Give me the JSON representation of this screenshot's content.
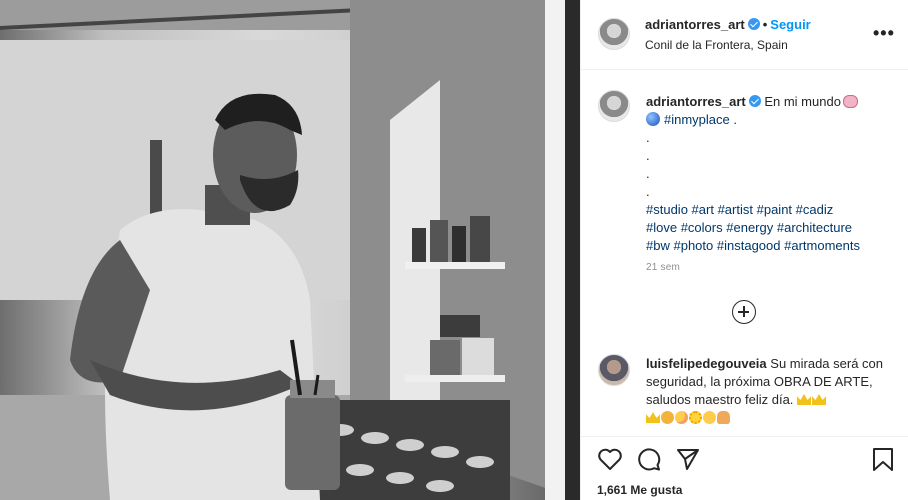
{
  "post": {
    "username": "adriantorres_art",
    "follow_label": "Seguir",
    "separator": "•",
    "location": "Conil de la Frontera, Spain",
    "more_label": "•••"
  },
  "caption": {
    "username": "adriantorres_art",
    "text": "En mi mundo",
    "place_tag": "#inmyplace",
    "place_suffix": ".",
    "dots": [
      ".",
      ".",
      ".",
      "."
    ],
    "hashtag_lines": [
      [
        "#studio",
        "#art",
        "#artist",
        "#paint",
        "#cadiz"
      ],
      [
        "#love",
        "#colors",
        "#energy",
        "#architecture"
      ],
      [
        "#bw",
        "#photo",
        "#instagood",
        "#artmoments"
      ]
    ],
    "time": "21 sem"
  },
  "comment": {
    "username": "luisfelipedegouveia",
    "text": "Su mirada será con seguridad, la próxima OBRA DE ARTE, saludos maestro feliz día."
  },
  "footer": {
    "likes": "1,661 Me gusta"
  },
  "icons": {
    "verified": "verified-badge-icon",
    "more": "more-options-icon",
    "add": "add-comment-icon",
    "like": "heart-icon",
    "comment": "comment-icon",
    "share": "share-icon",
    "save": "bookmark-icon"
  },
  "colors": {
    "accent": "#0095f6",
    "hashtag": "#00376b",
    "muted": "#8e8e8e",
    "verified": "#3897f0"
  }
}
